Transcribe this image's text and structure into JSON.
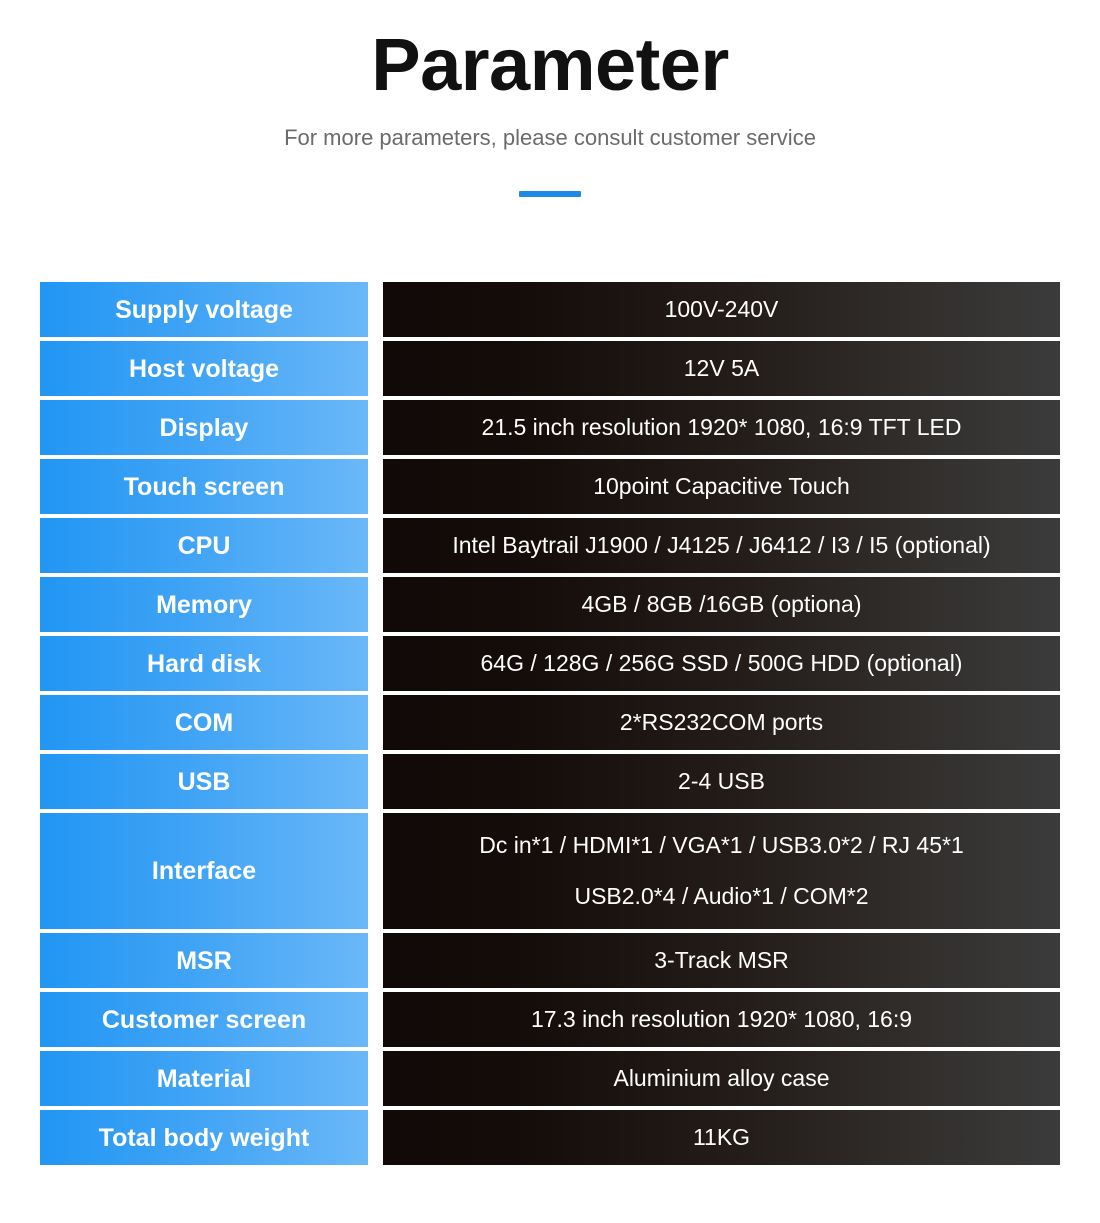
{
  "header": {
    "title": "Parameter",
    "subtitle": "For more parameters, please consult customer service",
    "accent_color": "#1e8ae8"
  },
  "colors": {
    "label_gradient_start": "#2196f3",
    "label_gradient_end": "#6ab8f8",
    "value_gradient_start": "#100907",
    "value_gradient_end": "#3b3b3b",
    "label_text": "#ffffff",
    "value_text": "#ffffff",
    "title_text": "#111111",
    "subtitle_text": "#6b6b6b",
    "page_background": "#ffffff"
  },
  "spec_table": {
    "rows": [
      {
        "label": "Supply voltage",
        "value_lines": [
          "100V-240V"
        ]
      },
      {
        "label": "Host voltage",
        "value_lines": [
          "12V 5A"
        ]
      },
      {
        "label": "Display",
        "value_lines": [
          "21.5 inch resolution 1920* 1080, 16:9 TFT LED"
        ]
      },
      {
        "label": "Touch screen",
        "value_lines": [
          "10point Capacitive Touch"
        ]
      },
      {
        "label": "CPU",
        "value_lines": [
          "Intel Baytrail J1900 / J4125 / J6412 / I3 / I5 (optional)"
        ]
      },
      {
        "label": "Memory",
        "value_lines": [
          "4GB / 8GB /16GB (optiona)"
        ]
      },
      {
        "label": "Hard disk",
        "value_lines": [
          "64G / 128G / 256G SSD / 500G HDD (optional)"
        ]
      },
      {
        "label": "COM",
        "value_lines": [
          "2*RS232COM ports"
        ]
      },
      {
        "label": "USB",
        "value_lines": [
          "2-4 USB"
        ]
      },
      {
        "label": "Interface",
        "value_lines": [
          "Dc in*1 / HDMI*1 / VGA*1 / USB3.0*2 / RJ 45*1",
          "USB2.0*4 / Audio*1 / COM*2"
        ]
      },
      {
        "label": "MSR",
        "value_lines": [
          "3-Track MSR"
        ]
      },
      {
        "label": "Customer screen",
        "value_lines": [
          "17.3 inch resolution 1920* 1080, 16:9"
        ]
      },
      {
        "label": "Material",
        "value_lines": [
          "Aluminium alloy case"
        ]
      },
      {
        "label": "Total body weight",
        "value_lines": [
          "11KG"
        ]
      }
    ]
  }
}
